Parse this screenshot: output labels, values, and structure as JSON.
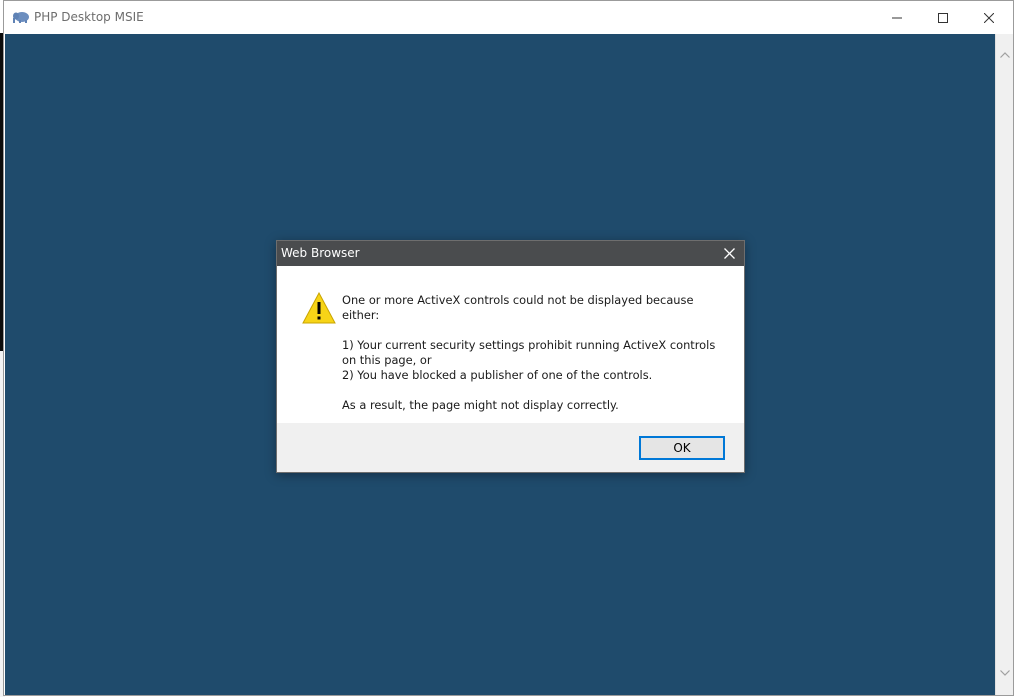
{
  "window": {
    "title": "PHP Desktop MSIE",
    "app_icon": "elephant-icon",
    "controls": {
      "minimize": "minimize-icon",
      "maximize": "maximize-icon",
      "close": "close-icon"
    },
    "content_bg": "#1f4b6c"
  },
  "dialog": {
    "title": "Web Browser",
    "close_icon": "close-icon",
    "warning_icon": "warning-icon",
    "line1": "One or more ActiveX controls could not be displayed because either:",
    "line2": "1) Your current security settings prohibit running ActiveX controls on this page, or",
    "line3": "2) You have blocked a publisher of one of the controls.",
    "line4": "As a result, the page might not display correctly.",
    "ok_label": "OK"
  }
}
